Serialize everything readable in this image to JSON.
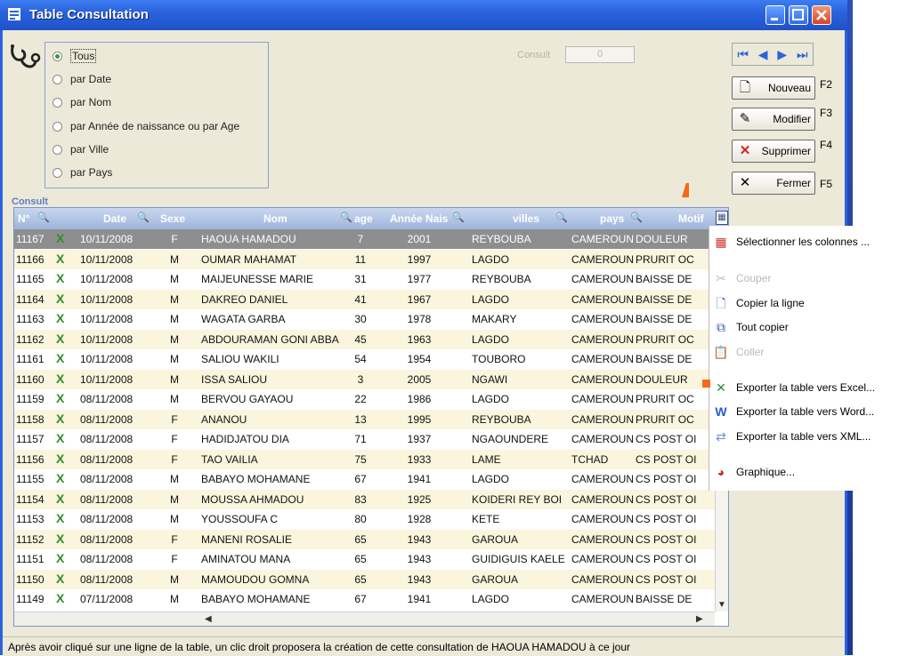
{
  "window": {
    "title": "Table Consultation"
  },
  "filter": {
    "options": [
      {
        "label": "Tous",
        "selected": true
      },
      {
        "label": "par Date",
        "selected": false
      },
      {
        "label": "par Nom",
        "selected": false
      },
      {
        "label": "par Année de naissance ou par Age",
        "selected": false
      },
      {
        "label": "par Ville",
        "selected": false
      },
      {
        "label": "par Pays",
        "selected": false
      }
    ]
  },
  "consult_field": {
    "label": "Consult",
    "value": "0"
  },
  "actions": {
    "nouveau": {
      "label": "Nouveau",
      "key": "F2"
    },
    "modifier": {
      "label": "Modifier",
      "key": "F3"
    },
    "supprimer": {
      "label": "Supprimer",
      "key": "F4"
    },
    "fermer": {
      "label": "Fermer",
      "key": "F5"
    }
  },
  "table": {
    "caption": "Consult",
    "columns": [
      "N°",
      "Date",
      "Sexe",
      "Nom",
      "age",
      "Année Nais",
      "villes",
      "pays",
      "Motif"
    ],
    "rows": [
      [
        "11167",
        "10/11/2008",
        "F",
        "HAOUA HAMADOU",
        "7",
        "2001",
        "REYBOUBA",
        "CAMEROUN",
        "DOULEUR"
      ],
      [
        "11166",
        "10/11/2008",
        "M",
        "OUMAR MAHAMAT",
        "11",
        "1997",
        "LAGDO",
        "CAMEROUN",
        "PRURIT OC"
      ],
      [
        "11165",
        "10/11/2008",
        "M",
        "MAIJEUNESSE MARIE",
        "31",
        "1977",
        "REYBOUBA",
        "CAMEROUN",
        "BAISSE DE"
      ],
      [
        "11164",
        "10/11/2008",
        "M",
        "DAKREO DANIEL",
        "41",
        "1967",
        "LAGDO",
        "CAMEROUN",
        "BAISSE DE"
      ],
      [
        "11163",
        "10/11/2008",
        "M",
        "WAGATA GARBA",
        "30",
        "1978",
        "MAKARY",
        "CAMEROUN",
        "BAISSE DE"
      ],
      [
        "11162",
        "10/11/2008",
        "M",
        "ABDOURAMAN GONI ABBA",
        "45",
        "1963",
        "LAGDO",
        "CAMEROUN",
        "PRURIT OC"
      ],
      [
        "11161",
        "10/11/2008",
        "M",
        "SALIOU WAKILI",
        "54",
        "1954",
        "TOUBORO",
        "CAMEROUN",
        "BAISSE DE"
      ],
      [
        "11160",
        "10/11/2008",
        "M",
        "ISSA SALIOU",
        "3",
        "2005",
        "NGAWI",
        "CAMEROUN",
        "DOULEUR"
      ],
      [
        "11159",
        "08/11/2008",
        "M",
        "BERVOU GAYAOU",
        "22",
        "1986",
        "LAGDO",
        "CAMEROUN",
        "PRURIT OC"
      ],
      [
        "11158",
        "08/11/2008",
        "F",
        "ANANOU",
        "13",
        "1995",
        "REYBOUBA",
        "CAMEROUN",
        "PRURIT OC"
      ],
      [
        "11157",
        "08/11/2008",
        "F",
        "HADIDJATOU DIA",
        "71",
        "1937",
        "NGAOUNDERE",
        "CAMEROUN",
        "CS POST OI"
      ],
      [
        "11156",
        "08/11/2008",
        "F",
        "TAO VAILIA",
        "75",
        "1933",
        "LAME",
        "TCHAD",
        "CS POST OI"
      ],
      [
        "11155",
        "08/11/2008",
        "M",
        "BABAYO MOHAMANE",
        "67",
        "1941",
        "LAGDO",
        "CAMEROUN",
        "CS POST OI"
      ],
      [
        "11154",
        "08/11/2008",
        "M",
        "MOUSSA AHMADOU",
        "83",
        "1925",
        "KOIDERI REY BOI",
        "CAMEROUN",
        "CS POST OI"
      ],
      [
        "11153",
        "08/11/2008",
        "M",
        "YOUSSOUFA C",
        "80",
        "1928",
        "KETE",
        "CAMEROUN",
        "CS POST OI"
      ],
      [
        "11152",
        "08/11/2008",
        "F",
        "MANENI ROSALIE",
        "65",
        "1943",
        "GAROUA",
        "CAMEROUN",
        "CS POST OI"
      ],
      [
        "11151",
        "08/11/2008",
        "F",
        "AMINATOU MANA",
        "65",
        "1943",
        "GUIDIGUIS KAELE",
        "CAMEROUN",
        "CS POST OI"
      ],
      [
        "11150",
        "08/11/2008",
        "M",
        "MAMOUDOU GOMNA",
        "65",
        "1943",
        "GAROUA",
        "CAMEROUN",
        "CS POST OI"
      ],
      [
        "11149",
        "07/11/2008",
        "M",
        "BABAYO MOHAMANE",
        "67",
        "1941",
        "LAGDO",
        "CAMEROUN",
        "BAISSE DE"
      ]
    ]
  },
  "context_menu": {
    "items": [
      {
        "label": "Sélectionner les colonnes ...",
        "icon": "columns-icon",
        "enabled": true
      },
      {
        "label": "Couper",
        "icon": "scissors-icon",
        "enabled": false
      },
      {
        "label": "Copier la ligne",
        "icon": "copy-row-icon",
        "enabled": true
      },
      {
        "label": "Tout copier",
        "icon": "copy-all-icon",
        "enabled": true
      },
      {
        "label": "Coller",
        "icon": "paste-icon",
        "enabled": false
      },
      {
        "label": "Exporter la table vers Excel...",
        "icon": "excel-icon",
        "enabled": true
      },
      {
        "label": "Exporter la table vers Word...",
        "icon": "word-icon",
        "enabled": true
      },
      {
        "label": "Exporter la table vers XML...",
        "icon": "xml-icon",
        "enabled": true
      },
      {
        "label": "Graphique...",
        "icon": "chart-icon",
        "enabled": true
      }
    ]
  },
  "status": {
    "text": "Après avoir cliqué sur une ligne de la table, un clic droit proposera la création de cette consultation de  HAOUA HAMADOU à ce jour"
  }
}
